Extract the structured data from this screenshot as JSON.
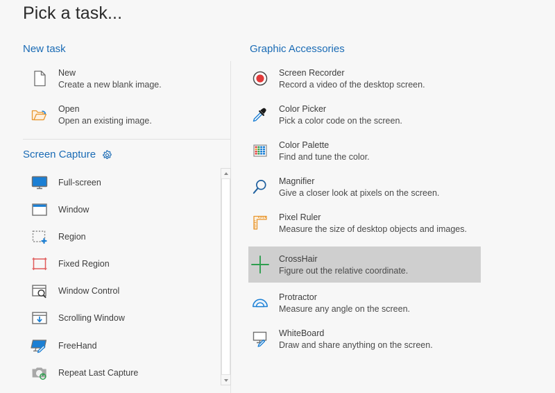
{
  "window": {
    "title": "Pick a task..."
  },
  "sections": {
    "new_task": {
      "heading": "New task",
      "items": [
        {
          "icon": "new-file-icon",
          "title": "New",
          "desc": "Create a new blank image."
        },
        {
          "icon": "open-folder-icon",
          "title": "Open",
          "desc": "Open an existing image."
        }
      ]
    },
    "screen_capture": {
      "heading": "Screen Capture",
      "settings_icon": "gear-icon",
      "items": [
        {
          "icon": "monitor-icon",
          "title": "Full-screen"
        },
        {
          "icon": "window-icon",
          "title": "Window"
        },
        {
          "icon": "region-dashed-icon",
          "title": "Region"
        },
        {
          "icon": "fixed-region-icon",
          "title": "Fixed Region"
        },
        {
          "icon": "window-control-icon",
          "title": "Window Control"
        },
        {
          "icon": "scrolling-window-icon",
          "title": "Scrolling Window"
        },
        {
          "icon": "freehand-icon",
          "title": "FreeHand"
        },
        {
          "icon": "repeat-capture-icon",
          "title": "Repeat Last Capture"
        }
      ],
      "scrollbar": {
        "up_arrow": "scroll-up-arrow",
        "down_arrow": "scroll-down-arrow"
      }
    },
    "graphic_accessories": {
      "heading": "Graphic Accessories",
      "items": [
        {
          "icon": "record-circle-icon",
          "title": "Screen Recorder",
          "desc": "Record a video of the desktop screen.",
          "selected": false
        },
        {
          "icon": "eyedropper-icon",
          "title": "Color Picker",
          "desc": "Pick a color code on the screen.",
          "selected": false
        },
        {
          "icon": "color-palette-icon",
          "title": "Color Palette",
          "desc": "Find and tune the color.",
          "selected": false
        },
        {
          "icon": "magnifier-icon",
          "title": "Magnifier",
          "desc": "Give a closer look at pixels on the screen.",
          "selected": false
        },
        {
          "icon": "pixel-ruler-icon",
          "title": "Pixel Ruler",
          "desc": "Measure the size of desktop objects and images.",
          "selected": false
        },
        {
          "icon": "crosshair-icon",
          "title": "CrossHair",
          "desc": "Figure out the relative coordinate.",
          "selected": true
        },
        {
          "icon": "protractor-icon",
          "title": "Protractor",
          "desc": "Measure any angle on the screen.",
          "selected": false
        },
        {
          "icon": "whiteboard-icon",
          "title": "WhiteBoard",
          "desc": "Draw and share anything on the screen.",
          "selected": false
        }
      ]
    }
  },
  "colors": {
    "background": "#f7f7f7",
    "heading_blue": "#1a6bb5",
    "accent_blue": "#1b7fd4",
    "selection_grey": "#cfcfcf",
    "record_red": "#e23b3b",
    "orange": "#e8962e",
    "green": "#2f9e4f"
  }
}
